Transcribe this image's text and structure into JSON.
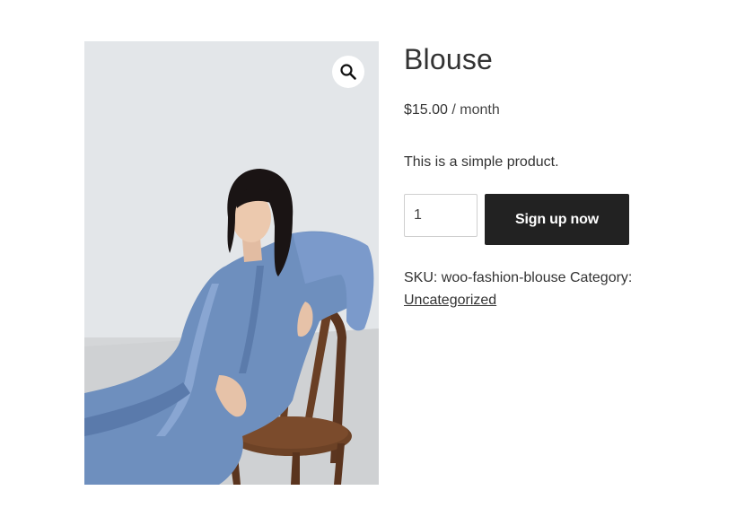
{
  "product": {
    "title": "Blouse",
    "price": "$15.00",
    "price_suffix": " / month",
    "description": "This is a simple product.",
    "quantity": "1",
    "button_label": "Sign up now",
    "sku_label": "SKU: ",
    "sku": "woo-fashion-blouse",
    "category_label": " Category: ",
    "category": "Uncategorized"
  },
  "icons": {
    "zoom": "magnifier-icon"
  },
  "colors": {
    "button_bg": "#222222",
    "button_text": "#ffffff",
    "text": "#333333",
    "dress": "#6e8fbe"
  }
}
